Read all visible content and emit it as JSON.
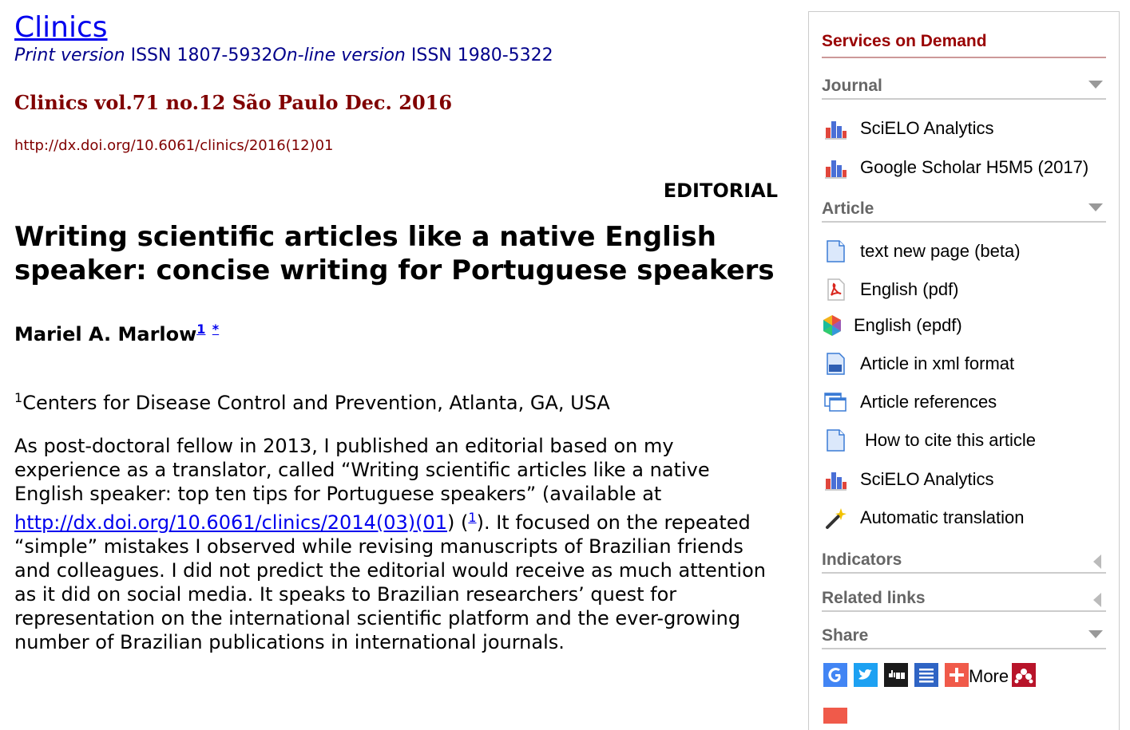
{
  "header": {
    "journal_title": "Clinics",
    "print_version_label": "Print version",
    "print_issn": "ISSN 1807-5932",
    "online_version_label": "On-line version",
    "online_issn": "ISSN 1980-5322",
    "issue": "Clinics vol.71 no.12 São Paulo Dec. 2016",
    "doi": "http://dx.doi.org/10.6061/clinics/2016(12)01"
  },
  "article": {
    "section": "EDITORIAL",
    "title": "Writing scientific articles like a native English speaker: concise writing for Portuguese speakers",
    "author_name": "Mariel A. Marlow",
    "author_sup": "1",
    "author_star": "*",
    "affil_sup": "1",
    "affiliation": "Centers for Disease Control and Prevention, Atlanta, GA, USA",
    "para1_before_link": "As post-doctoral fellow in 2013, I published an editorial based on my experience as a translator, called “Writing scientific articles like a native English speaker: top ten tips for Portuguese speakers” (available at ",
    "para1_link": "http://dx.doi.org/10.6061/clinics/2014(03)(01",
    "para1_mid": ") (",
    "para1_ref": "1",
    "para1_after": "). It focused on the repeated “simple” mistakes I observed while revising manuscripts of Brazilian friends and colleagues. I did not predict the editorial would receive as much attention as it did on social media. It speaks to Brazilian researchers’ quest for representation on the international scientific platform and the ever-growing number of Brazilian publications in international journals."
  },
  "sidebar": {
    "title": "Services on Demand",
    "journal_heading": "Journal",
    "journal_items": [
      {
        "label": "SciELO Analytics",
        "icon": "bar-chart-icon"
      },
      {
        "label": "Google Scholar H5M5 (2017)",
        "icon": "bar-chart-icon"
      }
    ],
    "article_heading": "Article",
    "article_items": [
      {
        "label": "text new page (beta)",
        "icon": "document-icon"
      },
      {
        "label": "English (pdf)",
        "icon": "pdf-icon"
      },
      {
        "label": "English (epdf)",
        "icon": "epdf-icon"
      },
      {
        "label": "Article in xml format",
        "icon": "xml-icon"
      },
      {
        "label": "Article references",
        "icon": "references-icon"
      },
      {
        "label": "How to cite this article",
        "icon": "document-icon"
      },
      {
        "label": "SciELO Analytics",
        "icon": "bar-chart-icon"
      },
      {
        "label": "Automatic translation",
        "icon": "wand-icon"
      }
    ],
    "indicators_heading": "Indicators",
    "related_heading": "Related links",
    "share_heading": "Share",
    "share_more": "More"
  },
  "colors": {
    "link": "#0000ee",
    "issue_red": "#800000",
    "sidebar_title": "#990000",
    "section_gray": "#666666"
  }
}
